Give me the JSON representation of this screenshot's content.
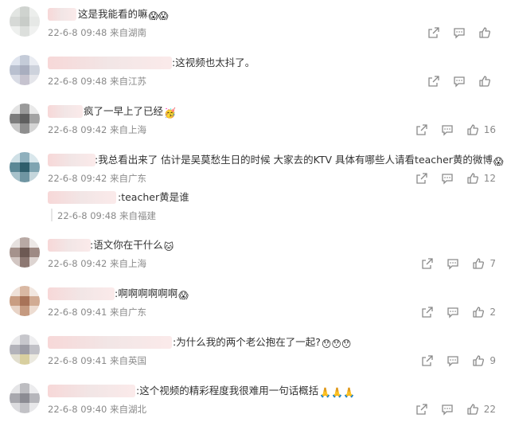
{
  "comments": [
    {
      "suffix": "这是我能看的嘛",
      "emoji": "😱😱",
      "time": "22-6-8 09:48",
      "location": "来自湖南",
      "likes": ""
    },
    {
      "suffix": ":这视频也太抖了。",
      "emoji": "",
      "time": "22-6-8 09:48",
      "location": "来自江苏",
      "likes": ""
    },
    {
      "suffix": "疯了一早上了已经",
      "emoji": "🥳",
      "time": "22-6-8 09:42",
      "location": "来自上海",
      "likes": "16"
    },
    {
      "suffix": ":我总看出来了 估计是吴莫愁生日的时候 大家去的KTV 具体有哪些人请看teacher黄的微博",
      "emoji": "😱",
      "time": "22-6-8 09:42",
      "location": "来自广东",
      "likes": "12"
    },
    {
      "suffix": ":语文你在干什么",
      "emoji": "🐱",
      "time": "22-6-8 09:42",
      "location": "来自上海",
      "likes": "7"
    },
    {
      "suffix": ":啊啊啊啊啊啊",
      "emoji": "😱",
      "time": "22-6-8 09:41",
      "location": "来自广东",
      "likes": "2"
    },
    {
      "suffix": ":为什么我的两个老公抱在了一起?",
      "emoji": "😯😯😯",
      "time": "22-6-8 09:41",
      "location": "来自英国",
      "likes": "9"
    },
    {
      "suffix": ":这个视频的精彩程度我很难用一句话概括",
      "emoji": "🙏🙏🙏",
      "time": "22-6-8 09:40",
      "location": "来自湖北",
      "likes": "22"
    }
  ],
  "reply": {
    "suffix": ":teacher黄是谁",
    "time": "22-6-8 09:48",
    "location": "来自福建"
  },
  "icons": {
    "share": "share-icon",
    "comment": "comment-icon",
    "like": "like-icon"
  },
  "colors": {
    "meta": "#8a8a8a",
    "text": "#333333",
    "background": "#ffffff"
  }
}
